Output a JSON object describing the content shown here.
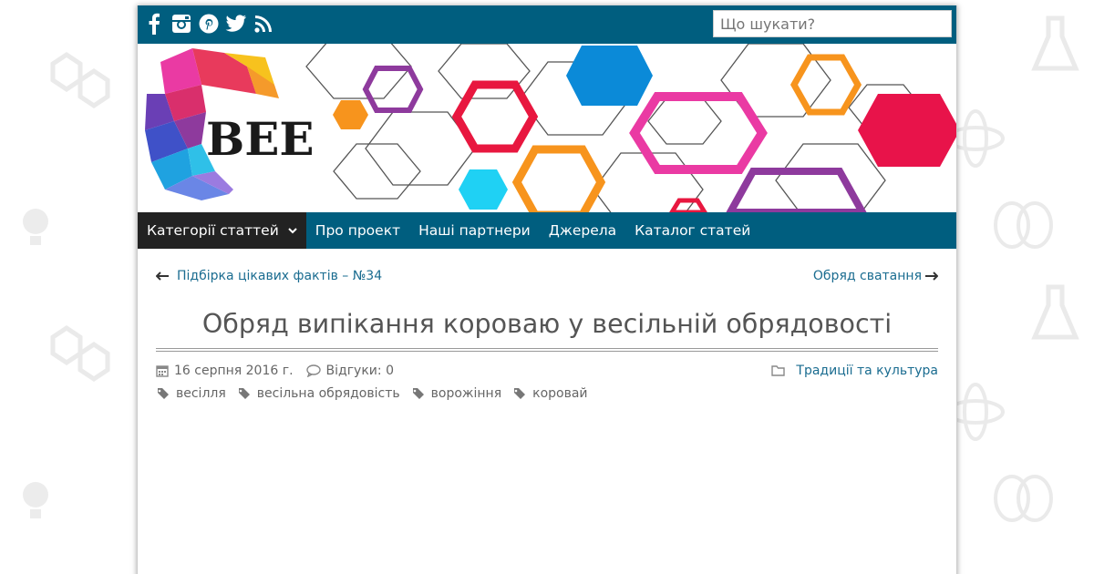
{
  "header": {
    "social_icons": [
      "facebook-icon",
      "instagram-icon",
      "pinterest-icon",
      "twitter-icon",
      "rss-icon"
    ],
    "search": {
      "placeholder": "Що шукати?"
    },
    "logo_text": "BEE"
  },
  "nav": {
    "items": [
      {
        "label": "Категорії статтей",
        "active": true,
        "has_dropdown": true
      },
      {
        "label": "Про проект"
      },
      {
        "label": "Наші партнери"
      },
      {
        "label": "Джерела"
      },
      {
        "label": "Каталог статей"
      }
    ]
  },
  "post_nav": {
    "prev_label": "Підбірка цікавих фактів – №34",
    "next_label": "Обряд сватання"
  },
  "article": {
    "title": "Обряд випікання короваю у весільній обрядовості",
    "date": "16 серпня 2016 г.",
    "comments": "Відгуки: 0",
    "category": "Традиції та культура",
    "tags": [
      "весілля",
      "весільна обрядовість",
      "ворожіння",
      "коровай"
    ]
  },
  "colors": {
    "header_bg": "#005e7f",
    "nav_active_bg": "#222222",
    "link": "#1a6c90"
  }
}
